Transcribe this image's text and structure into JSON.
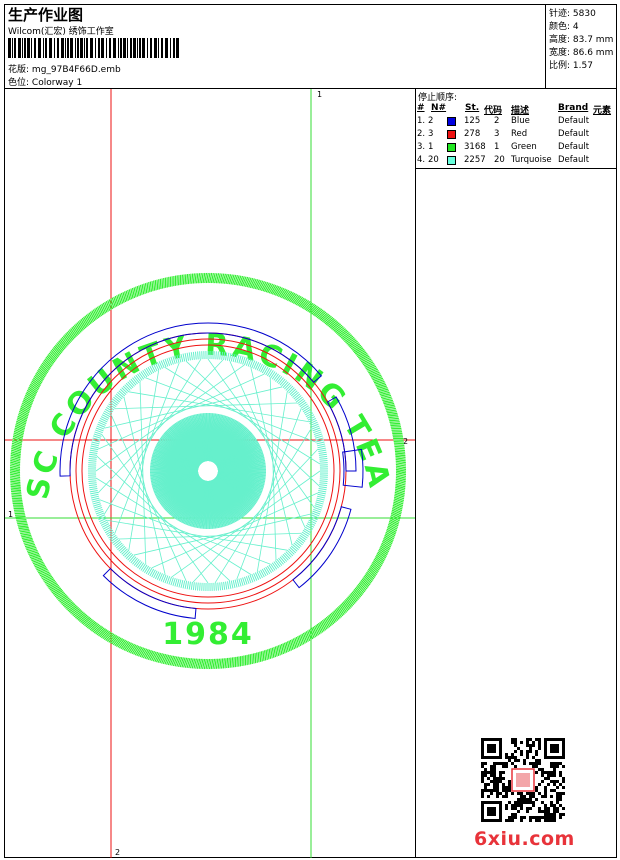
{
  "header": {
    "title": "生产作业图",
    "subtitle": "Wilcom(汇宏) 绣饰工作室",
    "design_label": "花版:",
    "design_file": "mg_97B4F66D.emb",
    "colorway_label": "色位:",
    "colorway": "Colorway 1"
  },
  "stats": [
    {
      "label": "针迹:",
      "value": "5830"
    },
    {
      "label": "颜色:",
      "value": "4"
    },
    {
      "label": "高度:",
      "value": "83.7 mm"
    },
    {
      "label": "宽度:",
      "value": "86.6 mm"
    },
    {
      "label": "比例:",
      "value": "1.57"
    }
  ],
  "stop_sequence": {
    "title": "停止顺序:",
    "columns": [
      "#",
      "N#",
      "St.",
      "代码",
      "描述",
      "Brand",
      "元素"
    ],
    "rows": [
      {
        "seq": "1.",
        "n": "2",
        "color": "#0000e0",
        "st": "125",
        "code": "2",
        "desc": "Blue",
        "brand": "Default"
      },
      {
        "seq": "2.",
        "n": "3",
        "color": "#ee1111",
        "st": "278",
        "code": "3",
        "desc": "Red",
        "brand": "Default"
      },
      {
        "seq": "3.",
        "n": "1",
        "color": "#22e822",
        "st": "3168",
        "code": "1",
        "desc": "Green",
        "brand": "Default"
      },
      {
        "seq": "4.",
        "n": "20",
        "color": "#66ffdd",
        "st": "2257",
        "code": "20",
        "desc": "Turquoise",
        "brand": "Default"
      }
    ]
  },
  "design": {
    "top_text": "ESC COUNTY RACING TEAM",
    "year": "1984",
    "colors": {
      "green": "#33ee33",
      "blue": "#0000cc",
      "red": "#ee1111",
      "turquoise": "#66f0cc"
    },
    "guide_labels": {
      "v_green": "1",
      "v_red": "2",
      "h_red": "2",
      "h_green": "1"
    }
  },
  "watermark": {
    "text": "6xiu.com",
    "color": "#e8333a"
  }
}
